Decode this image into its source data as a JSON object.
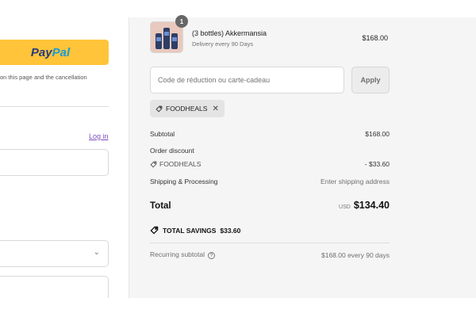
{
  "left": {
    "paypal_pay": "Pay",
    "paypal_pal": "Pal",
    "consent_text": "on this page and the cancellation",
    "login_link": "Log in",
    "select_chevron_icon": "chevron-down-icon"
  },
  "summary": {
    "item": {
      "quantity": "1",
      "name": "(3 bottles) Akkermansia",
      "delivery": "Delivery every 90 Days",
      "price": "$168.00"
    },
    "discount": {
      "placeholder": "Code de réduction ou carte-cadeau",
      "apply_label": "Apply",
      "applied_code": "FOODHEALS",
      "remove_icon": "close-icon"
    },
    "lines": {
      "subtotal_label": "Subtotal",
      "subtotal_value": "$168.00",
      "order_discount_label": "Order discount",
      "discount_code": "FOODHEALS",
      "discount_value": "- $33.60",
      "shipping_label": "Shipping & Processing",
      "shipping_value": "Enter shipping address"
    },
    "total": {
      "label": "Total",
      "currency": "USD",
      "amount": "$134.40"
    },
    "savings": {
      "label": "TOTAL SAVINGS",
      "amount": "$33.60"
    },
    "recurring": {
      "label": "Recurring subtotal",
      "help_icon": "?",
      "value": "$168.00 every 90 days"
    }
  },
  "colors": {
    "paypal_yellow": "#ffc439",
    "summary_bg": "#f5f5f5",
    "link_purple": "#7b4fbf"
  }
}
